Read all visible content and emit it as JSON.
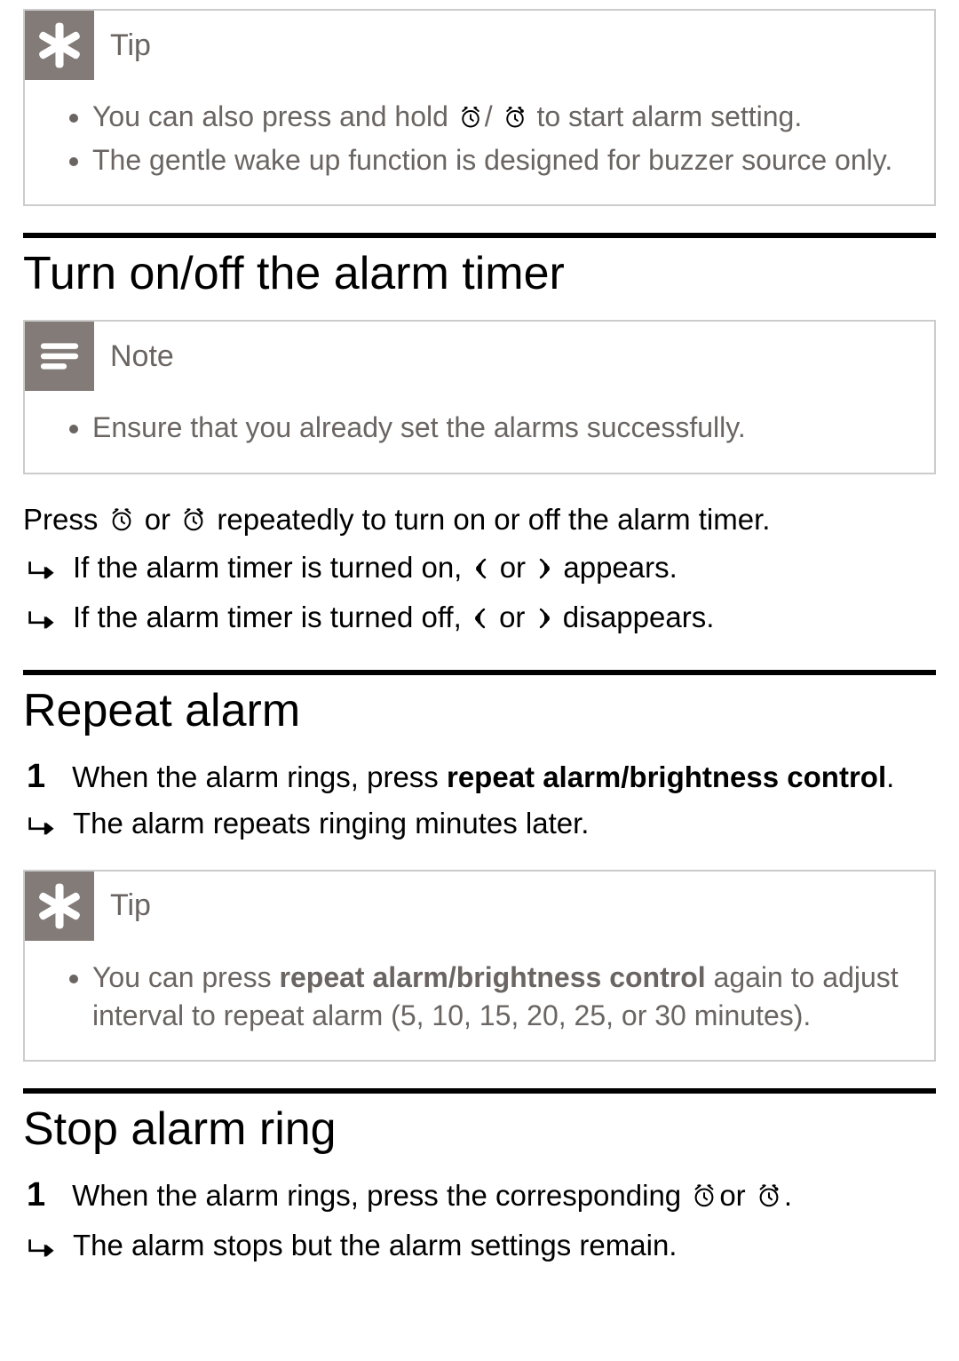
{
  "tip1": {
    "label": "Tip",
    "items": [
      {
        "pre": "You can also press and hold ",
        "mid": "/",
        "post": " to start alarm setting."
      },
      {
        "text": "The gentle wake up function is designed for buzzer source only."
      }
    ]
  },
  "section_turn": {
    "heading": "Turn on/off the alarm timer",
    "note": {
      "label": "Note",
      "items": [
        "Ensure that you already set the alarms successfully."
      ]
    },
    "para": {
      "pre": "Press ",
      "or": " or ",
      "post": " repeatedly to turn on or off the alarm timer."
    },
    "results": [
      {
        "pre": "If the alarm timer is turned on, ",
        "or": " or ",
        "post": " appears."
      },
      {
        "pre": "If the alarm timer is turned off, ",
        "or": " or ",
        "post": " disappears."
      }
    ]
  },
  "section_repeat": {
    "heading": "Repeat alarm",
    "step1": {
      "num": "1",
      "pre": "When the alarm rings, press ",
      "bold": "repeat alarm/brightness control",
      "post": "."
    },
    "result": "The alarm repeats ringing minutes later.",
    "tip": {
      "label": "Tip",
      "pre": "You can press ",
      "bold": "repeat alarm/brightness control",
      "post": " again to adjust interval to repeat alarm (5, 10, 15, 20, 25, or 30 minutes)."
    }
  },
  "section_stop": {
    "heading": "Stop alarm ring",
    "step1": {
      "num": "1",
      "pre": "When the alarm rings, press the corresponding ",
      "or": "or ",
      "post": "."
    },
    "result": "The alarm stops but the alarm settings remain."
  }
}
